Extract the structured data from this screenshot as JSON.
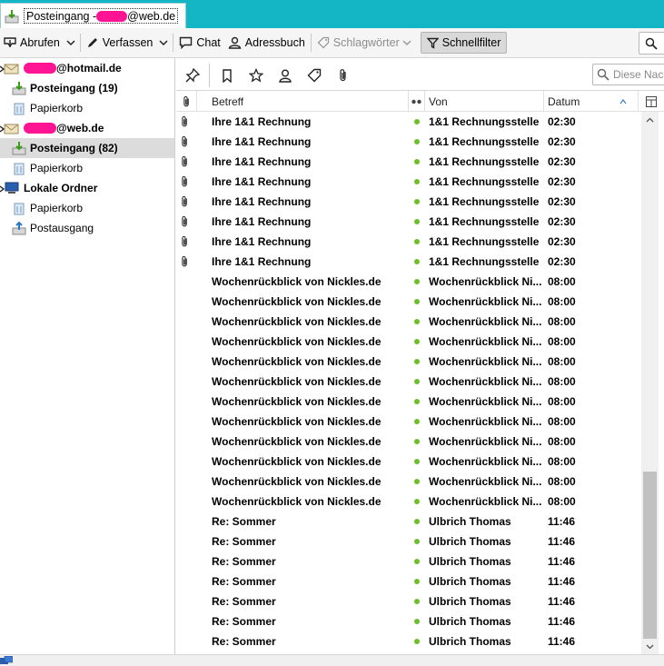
{
  "tab": {
    "title_prefix": "Posteingang - ",
    "title_suffix": "@web.de"
  },
  "toolbar": {
    "fetch_label": "Abrufen",
    "compose_label": "Verfassen",
    "chat_label": "Chat",
    "addressbook_label": "Adressbuch",
    "tags_label": "Schlagwörter",
    "quickfilter_label": "Schnellfilter"
  },
  "folders": {
    "account1_suffix": "@hotmail.de",
    "account1_inbox": "Posteingang (19)",
    "account1_trash": "Papierkorb",
    "account2_suffix": "@web.de",
    "account2_inbox": "Posteingang (82)",
    "account2_trash": "Papierkorb",
    "local_label": "Lokale Ordner",
    "local_trash": "Papierkorb",
    "local_outbox": "Postausgang"
  },
  "filterbar": {
    "search_placeholder": "Diese Nac"
  },
  "columns": {
    "subject": "Betreff",
    "from": "Von",
    "date": "Datum"
  },
  "messages": [
    {
      "subject": "Ihre 1&1 Rechnung",
      "from": "1&1 Rechnungsstelle",
      "date": "02:30",
      "attachment": true
    },
    {
      "subject": "Ihre 1&1 Rechnung",
      "from": "1&1 Rechnungsstelle",
      "date": "02:30",
      "attachment": true
    },
    {
      "subject": "Ihre 1&1 Rechnung",
      "from": "1&1 Rechnungsstelle",
      "date": "02:30",
      "attachment": true
    },
    {
      "subject": "Ihre 1&1 Rechnung",
      "from": "1&1 Rechnungsstelle",
      "date": "02:30",
      "attachment": true
    },
    {
      "subject": "Ihre 1&1 Rechnung",
      "from": "1&1 Rechnungsstelle",
      "date": "02:30",
      "attachment": true
    },
    {
      "subject": "Ihre 1&1 Rechnung",
      "from": "1&1 Rechnungsstelle",
      "date": "02:30",
      "attachment": true
    },
    {
      "subject": "Ihre 1&1 Rechnung",
      "from": "1&1 Rechnungsstelle",
      "date": "02:30",
      "attachment": true
    },
    {
      "subject": "Ihre 1&1 Rechnung",
      "from": "1&1 Rechnungsstelle",
      "date": "02:30",
      "attachment": true
    },
    {
      "subject": "Wochenrückblick von Nickles.de",
      "from": "Wochenrückblick Ni...",
      "date": "08:00",
      "attachment": false
    },
    {
      "subject": "Wochenrückblick von Nickles.de",
      "from": "Wochenrückblick Ni...",
      "date": "08:00",
      "attachment": false
    },
    {
      "subject": "Wochenrückblick von Nickles.de",
      "from": "Wochenrückblick Ni...",
      "date": "08:00",
      "attachment": false
    },
    {
      "subject": "Wochenrückblick von Nickles.de",
      "from": "Wochenrückblick Ni...",
      "date": "08:00",
      "attachment": false
    },
    {
      "subject": "Wochenrückblick von Nickles.de",
      "from": "Wochenrückblick Ni...",
      "date": "08:00",
      "attachment": false
    },
    {
      "subject": "Wochenrückblick von Nickles.de",
      "from": "Wochenrückblick Ni...",
      "date": "08:00",
      "attachment": false
    },
    {
      "subject": "Wochenrückblick von Nickles.de",
      "from": "Wochenrückblick Ni...",
      "date": "08:00",
      "attachment": false
    },
    {
      "subject": "Wochenrückblick von Nickles.de",
      "from": "Wochenrückblick Ni...",
      "date": "08:00",
      "attachment": false
    },
    {
      "subject": "Wochenrückblick von Nickles.de",
      "from": "Wochenrückblick Ni...",
      "date": "08:00",
      "attachment": false
    },
    {
      "subject": "Wochenrückblick von Nickles.de",
      "from": "Wochenrückblick Ni...",
      "date": "08:00",
      "attachment": false
    },
    {
      "subject": "Wochenrückblick von Nickles.de",
      "from": "Wochenrückblick Ni...",
      "date": "08:00",
      "attachment": false
    },
    {
      "subject": "Wochenrückblick von Nickles.de",
      "from": "Wochenrückblick Ni...",
      "date": "08:00",
      "attachment": false
    },
    {
      "subject": "Re: Sommer",
      "from": "Ulbrich Thomas",
      "date": "11:46",
      "attachment": false
    },
    {
      "subject": "Re: Sommer",
      "from": "Ulbrich Thomas",
      "date": "11:46",
      "attachment": false
    },
    {
      "subject": "Re: Sommer",
      "from": "Ulbrich Thomas",
      "date": "11:46",
      "attachment": false
    },
    {
      "subject": "Re: Sommer",
      "from": "Ulbrich Thomas",
      "date": "11:46",
      "attachment": false
    },
    {
      "subject": "Re: Sommer",
      "from": "Ulbrich Thomas",
      "date": "11:46",
      "attachment": false
    },
    {
      "subject": "Re: Sommer",
      "from": "Ulbrich Thomas",
      "date": "11:46",
      "attachment": false
    },
    {
      "subject": "Re: Sommer",
      "from": "Ulbrich Thomas",
      "date": "11:46",
      "attachment": false
    }
  ],
  "colors": {
    "tabbar": "#14b5c4",
    "redaction": "#ff1493",
    "read_dot": "#6cbf2a",
    "selected_folder": "#dcdcdc"
  }
}
